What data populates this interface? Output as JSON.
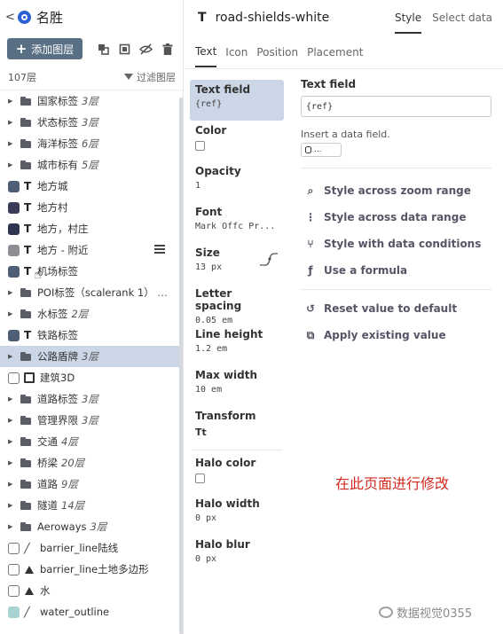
{
  "left": {
    "back": "<",
    "style_name": "名胜",
    "add_layer": "添加图层",
    "layer_count": "107层",
    "filter_label": "过滤图层",
    "layers": [
      {
        "kind": "folder",
        "label": "国家标签",
        "count": "3层"
      },
      {
        "kind": "folder",
        "label": "状态标签",
        "count": "3层"
      },
      {
        "kind": "folder",
        "label": "海洋标签",
        "count": "6层"
      },
      {
        "kind": "folder",
        "label": "城市标有",
        "count": "5层"
      },
      {
        "kind": "text",
        "label": "地方城",
        "color": "#4e5e76",
        "count": ""
      },
      {
        "kind": "text",
        "label": "地方村",
        "color": "#3b3b5a",
        "count": ""
      },
      {
        "kind": "text",
        "label": "地方，村庄",
        "color": "#2f3550",
        "count": ""
      },
      {
        "kind": "text",
        "label": "地方 - 附近",
        "color": "#8d8f94",
        "count": ""
      },
      {
        "kind": "text",
        "label": "机场标签",
        "color": "#4e5e76",
        "count": ""
      },
      {
        "kind": "folder",
        "label": "POI标签（scalerank 1）",
        "count": "…"
      },
      {
        "kind": "folder",
        "label": "水标签",
        "count": "2层"
      },
      {
        "kind": "text",
        "label": "铁路标签",
        "color": "#4e5e76",
        "count": ""
      },
      {
        "kind": "folder",
        "label": "公路盾牌",
        "count": "3层"
      },
      {
        "kind": "cube",
        "label": "建筑3D",
        "color": "#ffffff",
        "count": ""
      },
      {
        "kind": "folder",
        "label": "道路标签",
        "count": "3层"
      },
      {
        "kind": "folder",
        "label": "管理界限",
        "count": "3层"
      },
      {
        "kind": "folder",
        "label": "交通",
        "count": "4层"
      },
      {
        "kind": "folder",
        "label": "桥梁",
        "count": "20层"
      },
      {
        "kind": "folder",
        "label": "道路",
        "count": "9层"
      },
      {
        "kind": "folder",
        "label": "隧道",
        "count": "14层"
      },
      {
        "kind": "folder",
        "label": "Aeroways",
        "count": "3层"
      },
      {
        "kind": "line",
        "label": "barrier_line陆线",
        "color": "#ffffff",
        "count": ""
      },
      {
        "kind": "fill",
        "label": "barrier_line土地多边形",
        "color": "#ffffff",
        "count": ""
      },
      {
        "kind": "fill",
        "label": "水",
        "color": "#ffffff",
        "count": ""
      },
      {
        "kind": "line",
        "label": "water_outline",
        "color": "#a9d3d3",
        "count": ""
      }
    ]
  },
  "right": {
    "layer_type_glyph": "T",
    "layer_id": "road-shields-white",
    "top_tabs": [
      "Style",
      "Select data"
    ],
    "sub_tabs": [
      "Text",
      "Icon",
      "Position",
      "Placement"
    ],
    "properties": {
      "text_field": {
        "name": "Text field",
        "value": "{ref}"
      },
      "color": {
        "name": "Color"
      },
      "opacity": {
        "name": "Opacity",
        "value": "1"
      },
      "font": {
        "name": "Font",
        "value": "Mark Offc Pr..."
      },
      "size": {
        "name": "Size",
        "value": "13 px"
      },
      "letter_spacing": {
        "name": "Letter spacing",
        "value": "0.05 em"
      },
      "line_height": {
        "name": "Line height",
        "value": "1.2 em"
      },
      "max_width": {
        "name": "Max width",
        "value": "10 em"
      },
      "transform": {
        "name": "Transform",
        "value": "Tt"
      },
      "halo_color": {
        "name": "Halo color"
      },
      "halo_width": {
        "name": "Halo width",
        "value": "0 px"
      },
      "halo_blur": {
        "name": "Halo blur",
        "value": "0 px"
      }
    },
    "detail": {
      "title": "Text field",
      "input_value": "{ref}",
      "hint": "Insert a data field.",
      "chip": "...",
      "actions": [
        "Style across zoom range",
        "Style across data range",
        "Style with data conditions",
        "Use a formula"
      ],
      "actions2": [
        "Reset value to default",
        "Apply existing value"
      ]
    },
    "annotation": "在此页面进行修改",
    "watermark": "数据视觉0355"
  }
}
